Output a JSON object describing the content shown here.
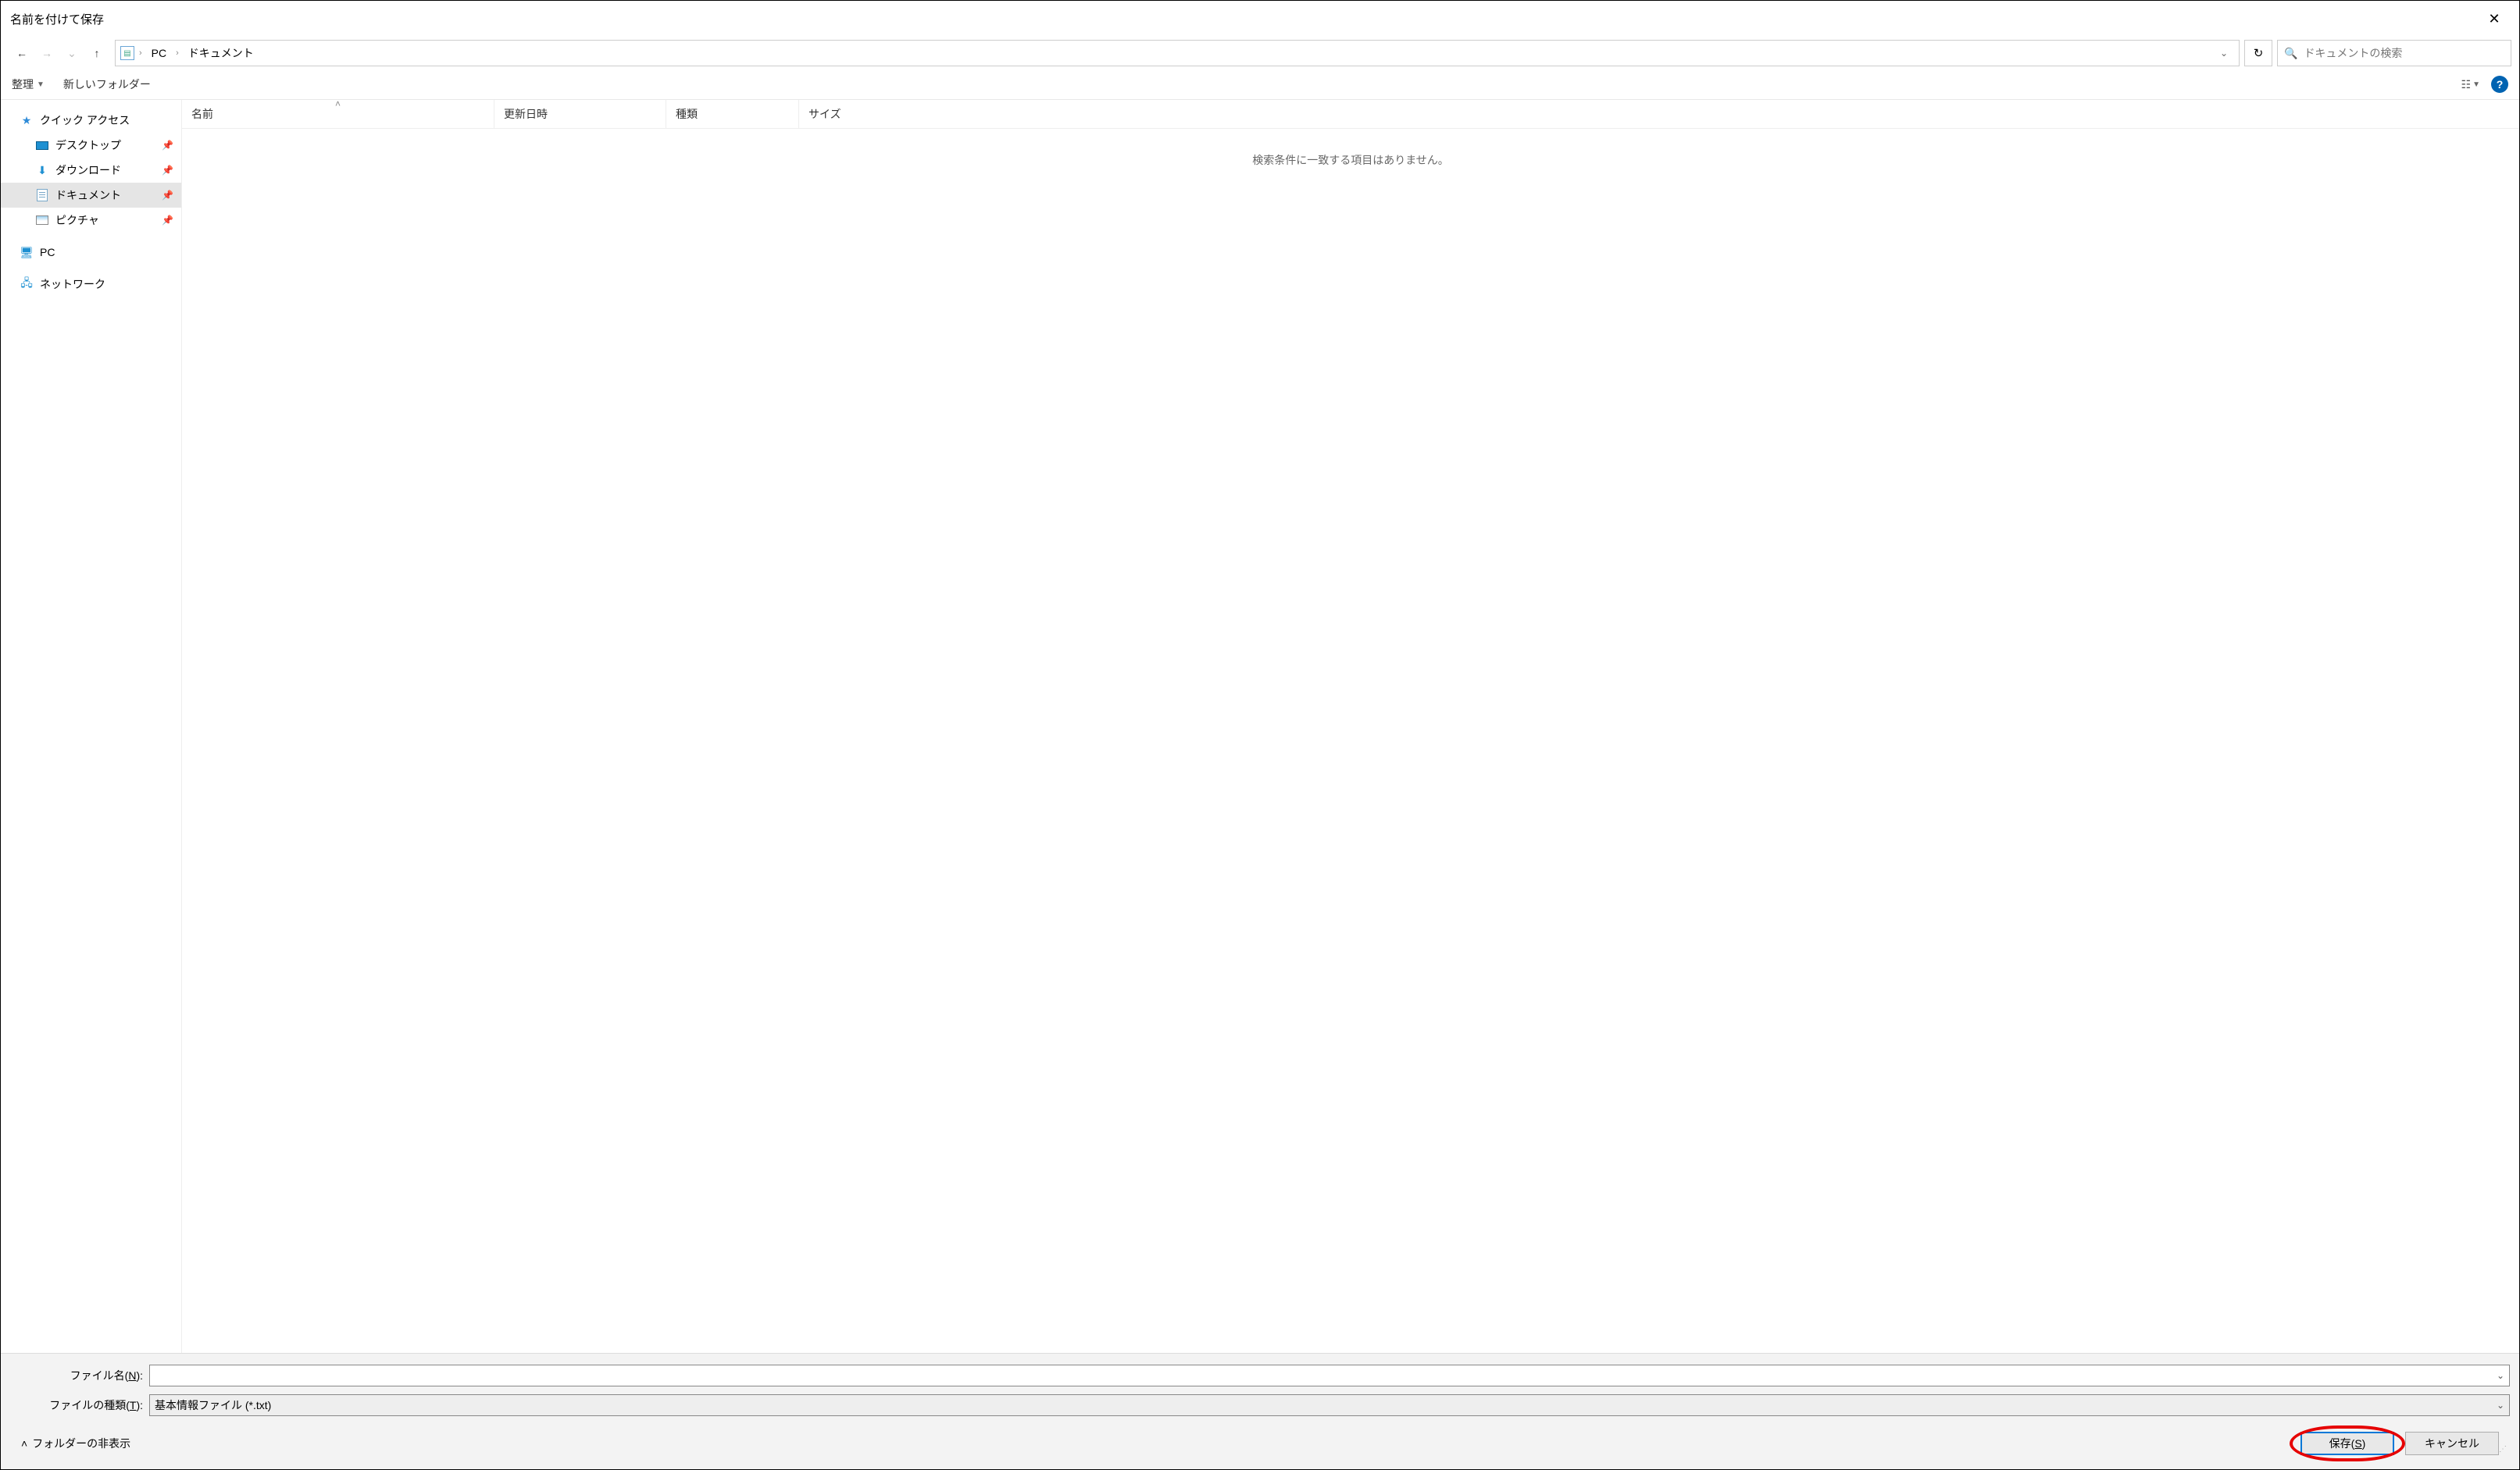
{
  "title": "名前を付けて保存",
  "breadcrumb": {
    "root": "PC",
    "folder": "ドキュメント"
  },
  "search": {
    "placeholder": "ドキュメントの検索"
  },
  "toolbar": {
    "organize": "整理",
    "new_folder": "新しいフォルダー"
  },
  "sidebar": {
    "quick_access": "クイック アクセス",
    "desktop": "デスクトップ",
    "downloads": "ダウンロード",
    "documents": "ドキュメント",
    "pictures": "ピクチャ",
    "pc": "PC",
    "network": "ネットワーク"
  },
  "columns": {
    "name": "名前",
    "date": "更新日時",
    "type": "種類",
    "size": "サイズ"
  },
  "empty_message": "検索条件に一致する項目はありません。",
  "fields": {
    "filename_label_pre": "ファイル名(",
    "filename_label_u": "N",
    "filename_label_post": "):",
    "filetype_label_pre": "ファイルの種類(",
    "filetype_label_u": "T",
    "filetype_label_post": "):",
    "filename_value": "",
    "filetype_value": "基本情報ファイル (*.txt)"
  },
  "footer": {
    "hide_folders": "フォルダーの非表示",
    "save_pre": "保存(",
    "save_u": "S",
    "save_post": ")",
    "cancel": "キャンセル"
  }
}
